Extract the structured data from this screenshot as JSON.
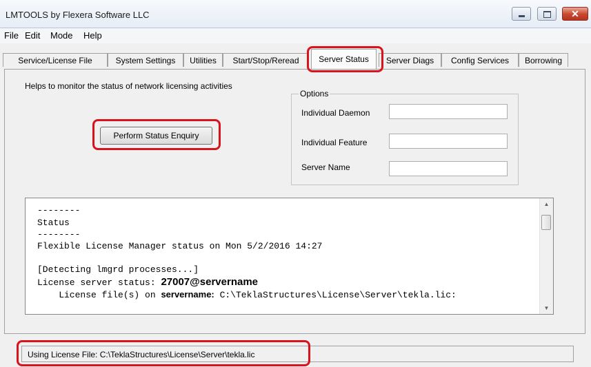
{
  "window": {
    "title": "LMTOOLS by Flexera Software LLC",
    "close_glyph": "✕"
  },
  "menu": [
    "File",
    "Edit",
    "Mode",
    "Help"
  ],
  "tabs": [
    "Service/License File",
    "System Settings",
    "Utilities",
    "Start/Stop/Reread",
    "Server Status",
    "Server Diags",
    "Config Services",
    "Borrowing"
  ],
  "active_tab": "Server Status",
  "server_status": {
    "description": "Helps to monitor the status of network licensing activities",
    "enquiry_button": "Perform Status Enquiry",
    "options": {
      "legend": "Options",
      "fields": [
        {
          "label": "Individual Daemon",
          "value": ""
        },
        {
          "label": "Individual Feature",
          "value": ""
        },
        {
          "label": "Server Name",
          "value": ""
        }
      ]
    },
    "output": {
      "dashes1": "--------",
      "status": "Status",
      "dashes2": "--------",
      "manager_status": "Flexible License Manager status on Mon 5/2/2016 14:27",
      "detecting": "[Detecting lmgrd processes...]",
      "server_status_label": "License server status: ",
      "server_status_value": "27007@servername",
      "license_files_indent": "    License file(s) on ",
      "license_files_server": "servername:",
      "license_files_path": " C:\\TeklaStructures\\License\\Server\\tekla.lic:"
    }
  },
  "status_bar": {
    "text": "Using License File:  C:\\TeklaStructures\\License\\Server\\tekla.lic"
  },
  "icons": {
    "scroll_up": "▲",
    "scroll_down": "▼"
  },
  "colors": {
    "highlight": "#d9131b"
  }
}
